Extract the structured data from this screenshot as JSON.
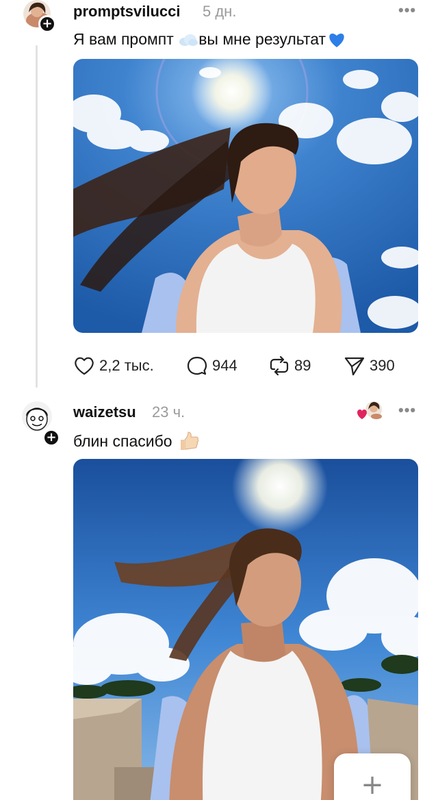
{
  "post1": {
    "username": "promptsvilucci",
    "time": "5 дн.",
    "text_before": "Я вам промпт ",
    "text_middle": "вы мне результат",
    "more_label": "•••",
    "actions": {
      "likes": "2,2 тыс.",
      "comments": "944",
      "reposts": "89",
      "shares": "390"
    }
  },
  "post2": {
    "username": "waizetsu",
    "time": "23 ч.",
    "text": "блин спасибо",
    "more_label": "•••"
  },
  "fab": {
    "label": "+"
  },
  "colors": {
    "text": "#111111",
    "muted": "#9a9a9a",
    "sky": "#2f6fc0",
    "heart": "#e0245e",
    "blue_heart": "#2d7ee8"
  },
  "icons": [
    "heart-icon",
    "comment-icon",
    "repost-icon",
    "send-icon",
    "cloud-emoji",
    "blue-heart-emoji",
    "thumbs-up-emoji",
    "plus-icon"
  ]
}
